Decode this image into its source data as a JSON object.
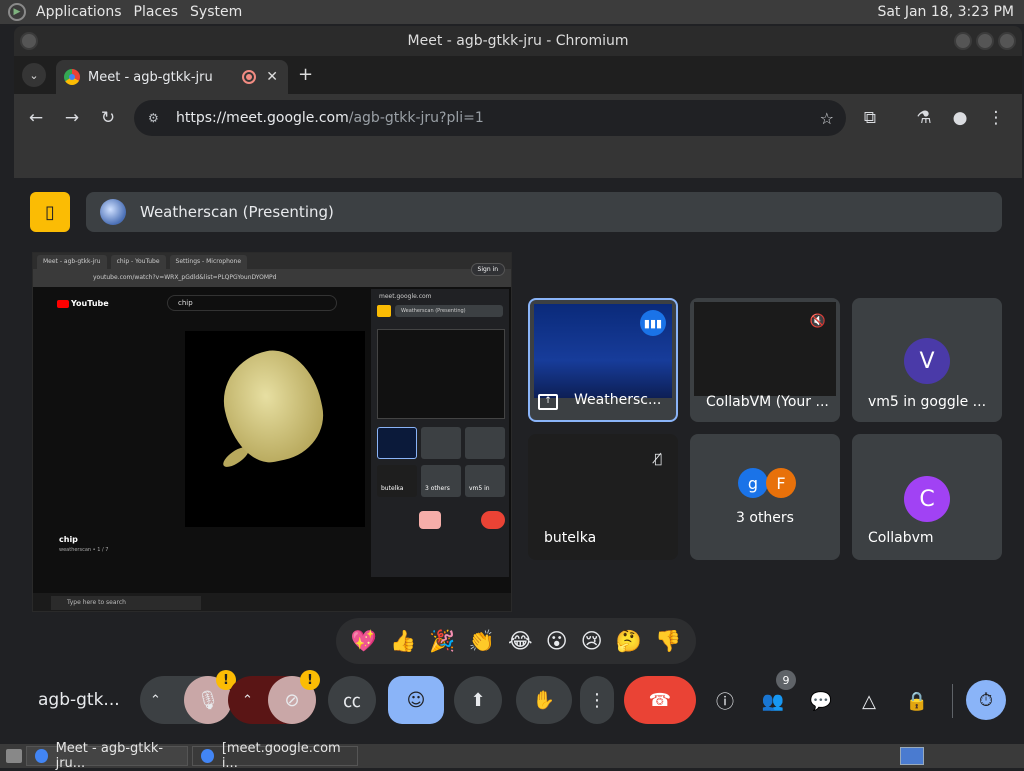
{
  "os": {
    "menus": [
      "Applications",
      "Places",
      "System"
    ],
    "clock": "Sat Jan 18,  3:23 PM"
  },
  "window": {
    "title": "Meet - agb-gtkk-jru - Chromium"
  },
  "browser": {
    "tab_title": "Meet - agb-gtkk-jru",
    "tab_close": "✕",
    "new_tab": "+",
    "url_host": "https://meet.google.com",
    "url_path": "/agb-gtkk-jru?pli=1"
  },
  "meet": {
    "presenting_label": "Weatherscan (Presenting)",
    "shared_screen": {
      "tabs": [
        "Meet - agb-gtkk-jru",
        "chip - YouTube",
        "Settings - Microphone"
      ],
      "url": "youtube.com/watch?v=WRX_pGdld&list=PLQPGYounDYOMPd",
      "yt_brand": "YouTube",
      "yt_search": "chip",
      "video_title": "chip",
      "video_sub": "weatherscan • 1 / 7",
      "taskbar_search": "Type here to search",
      "meet_host": "meet.google.com",
      "meet_presenting": "Weatherscan (Presenting)",
      "sign_in": "Sign in",
      "mini_names": [
        "butelka",
        "3 others",
        "vm5 in"
      ]
    },
    "tiles": [
      {
        "name": "Weathersc..."
      },
      {
        "name": "CollabVM (Your ..."
      },
      {
        "name": "vm5 in goggle ...",
        "initial": "V",
        "color": "#4a3aa8"
      },
      {
        "name": "butelka"
      },
      {
        "name": "3 others",
        "initials": [
          "g",
          "F"
        ],
        "colors": [
          "#1a73e8",
          "#e8710a"
        ]
      },
      {
        "name": "Collabvm",
        "initial": "C",
        "color": "#a142f4"
      }
    ],
    "reactions": [
      "💖",
      "👍",
      "🎉",
      "👏",
      "😂",
      "😮",
      "😢",
      "🤔",
      "👎"
    ],
    "meeting_code": "agb-gtk...",
    "warning_badge": "!",
    "people_count": "9",
    "accent_colors": {
      "hangup": "#ea4335",
      "active": "#8ab4f8",
      "warning": "#fbbc04"
    }
  },
  "taskbar": {
    "items": [
      "Meet - agb-gtkk-jru...",
      "[meet.google.com i..."
    ]
  }
}
